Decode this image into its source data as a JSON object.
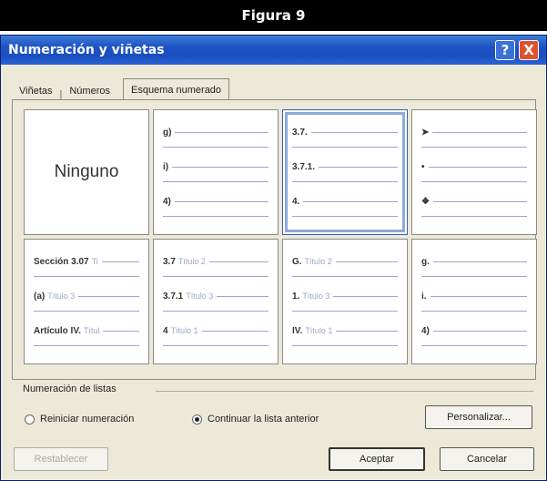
{
  "figure_caption": "Figura 9",
  "dialog": {
    "title": "Numeración y viñetas",
    "help_label": "?",
    "close_label": "X"
  },
  "tabs": [
    {
      "label": "Viñetas"
    },
    {
      "label": "Números"
    },
    {
      "label": "Esquema numerado"
    }
  ],
  "tab_separator": "|",
  "gallery": [
    {
      "type": "none",
      "label": "Ninguno"
    },
    {
      "type": "list",
      "rows": [
        {
          "marker": "g)",
          "text": ""
        },
        {
          "marker": "i)",
          "text": ""
        },
        {
          "marker": "4)",
          "text": ""
        }
      ]
    },
    {
      "type": "list",
      "selected": true,
      "rows": [
        {
          "marker": "3.7.",
          "text": ""
        },
        {
          "marker": "3.7.1.",
          "text": ""
        },
        {
          "marker": "4.",
          "text": ""
        }
      ]
    },
    {
      "type": "list",
      "rows": [
        {
          "marker": "➤",
          "text": ""
        },
        {
          "marker": "•",
          "text": ""
        },
        {
          "marker": "❖",
          "text": ""
        }
      ]
    },
    {
      "type": "list",
      "rows": [
        {
          "marker": "Sección 3.07",
          "text": "Ti"
        },
        {
          "marker": "(a)",
          "text": "Título 3"
        },
        {
          "marker": "Artículo IV.",
          "text": "Títul"
        }
      ]
    },
    {
      "type": "list",
      "rows": [
        {
          "marker": "3.7",
          "text": "Título 2"
        },
        {
          "marker": "3.7.1",
          "text": "Título 3"
        },
        {
          "marker": "4",
          "text": "Título 1"
        }
      ]
    },
    {
      "type": "list",
      "rows": [
        {
          "marker": "G.",
          "text": "Título 2"
        },
        {
          "marker": "1.",
          "text": "Título 3"
        },
        {
          "marker": "IV.",
          "text": "Título 1"
        }
      ]
    },
    {
      "type": "list",
      "rows": [
        {
          "marker": "g.",
          "text": ""
        },
        {
          "marker": "i.",
          "text": ""
        },
        {
          "marker": "4)",
          "text": ""
        }
      ]
    }
  ],
  "list_numbering": {
    "title": "Numeración de listas",
    "restart_label": "Reiniciar numeración",
    "continue_label": "Continuar la lista anterior",
    "selected": "continue"
  },
  "buttons": {
    "customize": "Personalizar...",
    "reset": "Restablecer",
    "ok": "Aceptar",
    "cancel": "Cancelar"
  }
}
